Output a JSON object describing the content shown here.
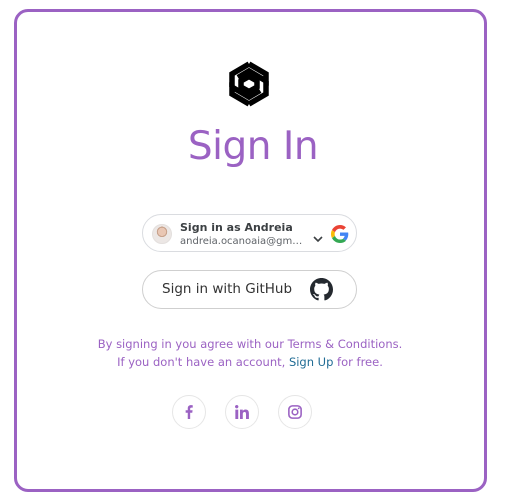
{
  "page": {
    "title": "Sign In"
  },
  "google_signin": {
    "label": "Sign in as Andreia",
    "email": "andreia.ocanoaia@gmail.com",
    "icons": [
      "user-avatar",
      "chevron-down-icon",
      "google-icon"
    ]
  },
  "github_signin": {
    "label": "Sign in with GitHub",
    "icon": "github-icon"
  },
  "terms": {
    "line1": "By signing in you agree with our Terms & Conditions.",
    "line2_before": "If you don't have an account, ",
    "signup_link": "Sign Up",
    "line2_after": " for free."
  },
  "social": {
    "items": [
      "facebook-icon",
      "linkedin-icon",
      "instagram-icon"
    ]
  },
  "colors": {
    "accent": "#9b62c3",
    "link": "#1f6b94"
  }
}
